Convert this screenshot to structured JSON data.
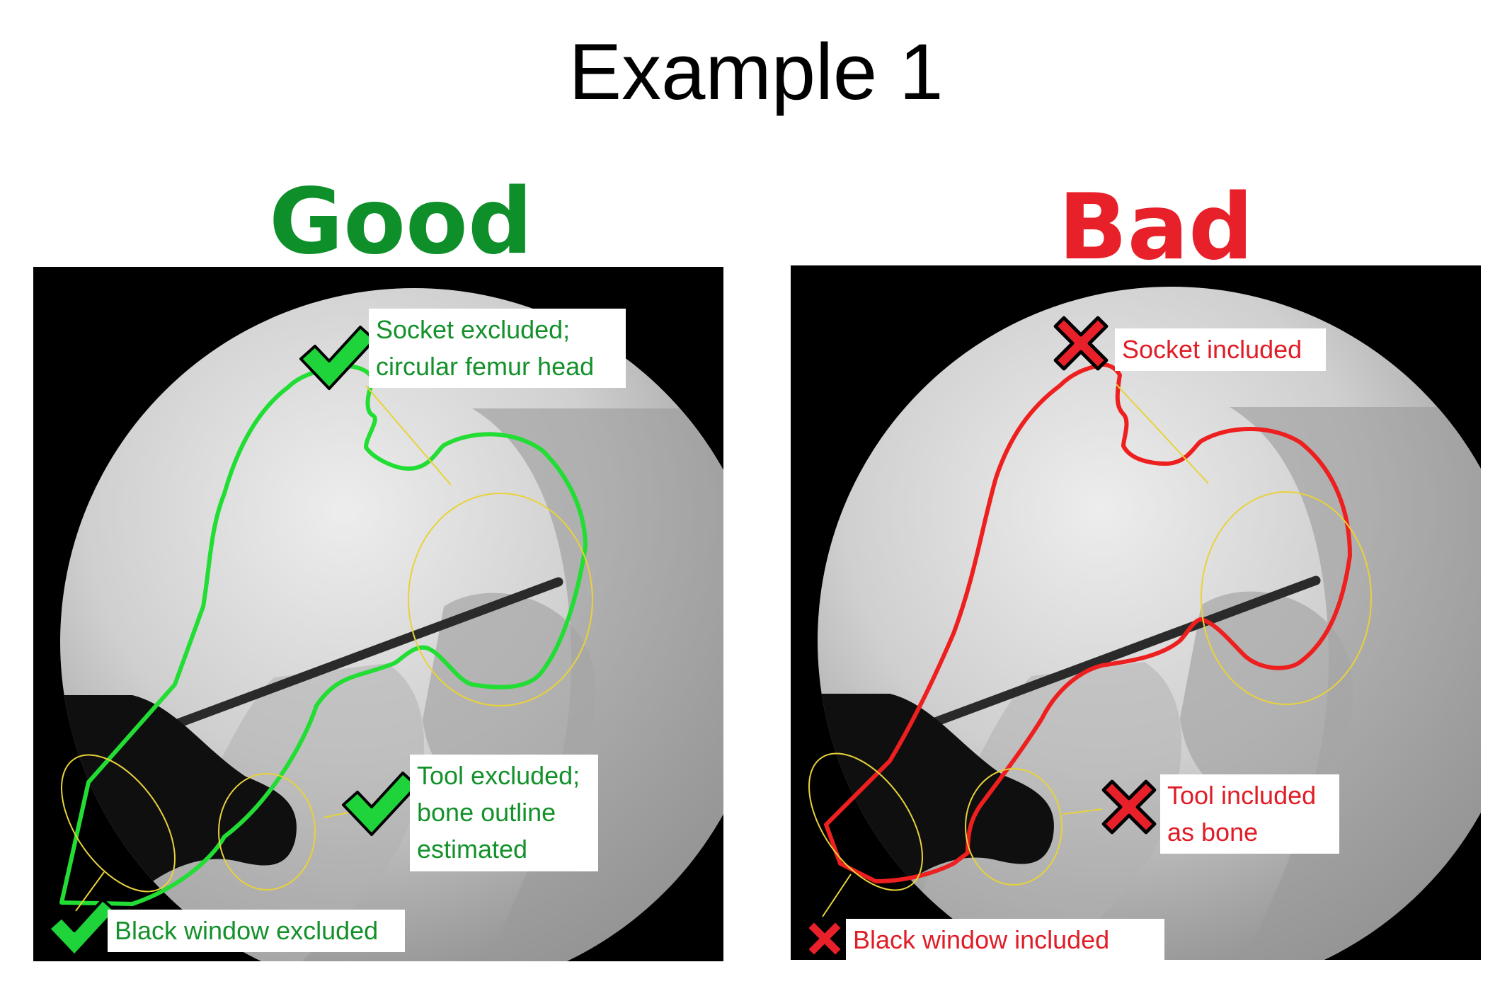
{
  "title": "Example 1",
  "good": {
    "heading": "Good",
    "color": "#0e8f2a",
    "outline_color": "#22dd33",
    "labels": {
      "socket": [
        "Socket excluded;",
        "circular femur head"
      ],
      "tool": [
        "Tool excluded;",
        "bone outline",
        "estimated"
      ],
      "window": [
        "Black window excluded"
      ]
    },
    "icons": [
      "check-icon",
      "check-icon",
      "check-icon"
    ]
  },
  "bad": {
    "heading": "Bad",
    "color": "#e8202a",
    "outline_color": "#ee1f1f",
    "labels": {
      "socket": [
        "Socket included"
      ],
      "tool": [
        "Tool included",
        "as bone"
      ],
      "window": [
        "Black window included"
      ]
    },
    "icons": [
      "cross-icon",
      "cross-icon",
      "cross-icon"
    ]
  },
  "annotation_color": "#e8d23a"
}
